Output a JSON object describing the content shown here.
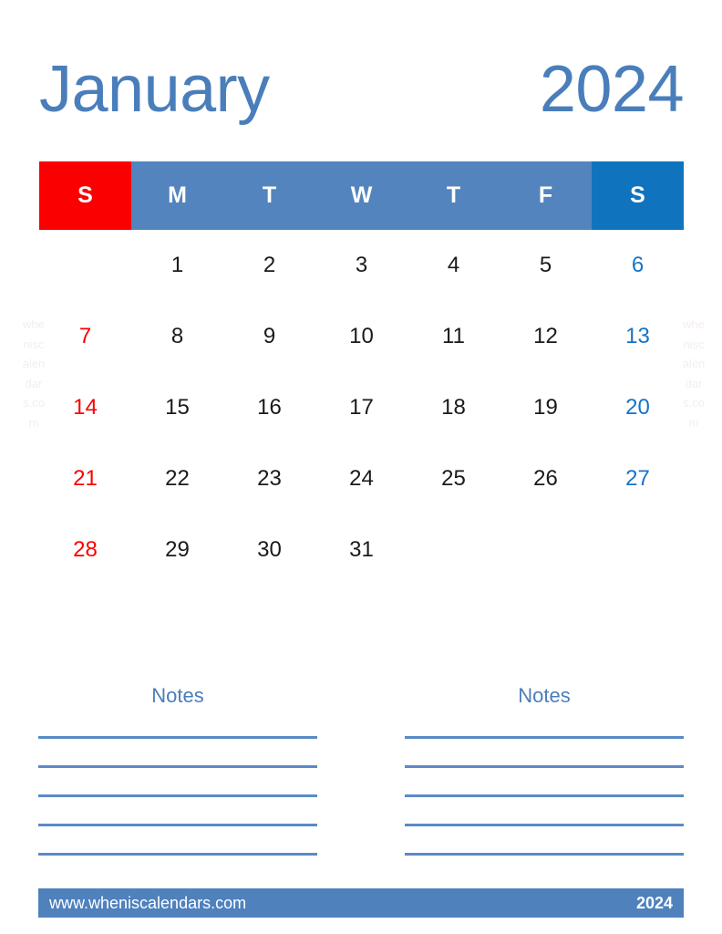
{
  "title": {
    "month": "January",
    "year": "2024"
  },
  "colors": {
    "accent_blue": "#4a7ebb",
    "header_weekday": "#5384be",
    "header_sunday": "#fb0000",
    "header_saturday": "#1073bd",
    "sunday_text": "#fb0000",
    "saturday_text": "#1673c8",
    "weekday_text": "#1a1a1a",
    "footer_bar": "#4f81bd",
    "note_line": "#5a8ac6",
    "watermark": "#f4eeee"
  },
  "weekdays": [
    {
      "label": "S",
      "kind": "sun"
    },
    {
      "label": "M",
      "kind": "weekday"
    },
    {
      "label": "T",
      "kind": "weekday"
    },
    {
      "label": "W",
      "kind": "weekday"
    },
    {
      "label": "T",
      "kind": "weekday"
    },
    {
      "label": "F",
      "kind": "weekday"
    },
    {
      "label": "S",
      "kind": "sat"
    }
  ],
  "weeks": [
    [
      "",
      "1",
      "2",
      "3",
      "4",
      "5",
      "6"
    ],
    [
      "7",
      "8",
      "9",
      "10",
      "11",
      "12",
      "13"
    ],
    [
      "14",
      "15",
      "16",
      "17",
      "18",
      "19",
      "20"
    ],
    [
      "21",
      "22",
      "23",
      "24",
      "25",
      "26",
      "27"
    ],
    [
      "28",
      "29",
      "30",
      "31",
      "",
      "",
      ""
    ]
  ],
  "watermark": {
    "text": "wheniscalendars.com"
  },
  "notes": {
    "left": {
      "title": "Notes",
      "line_count": 5
    },
    "right": {
      "title": "Notes",
      "line_count": 5
    }
  },
  "footer": {
    "url": "www.wheniscalendars.com",
    "year": "2024"
  }
}
